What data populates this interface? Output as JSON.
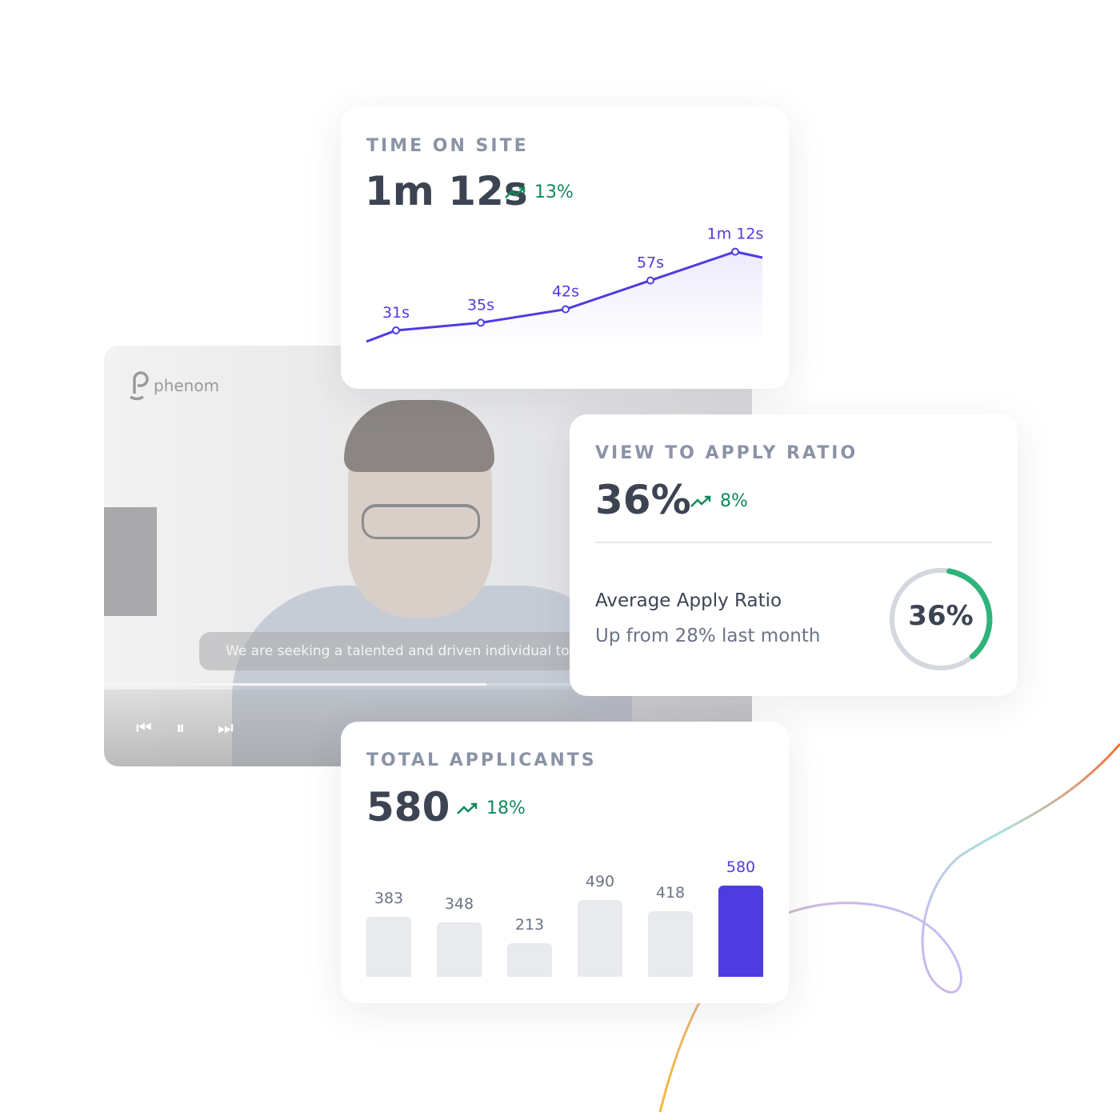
{
  "video": {
    "brand": "phenom",
    "caption": "We are seeking a talented and driven individual to",
    "progress": 0.59
  },
  "time_on_site": {
    "label": "TIME ON SITE",
    "value": "1m 12s",
    "trend": "13%",
    "points": [
      {
        "label": "31s",
        "seconds": 31
      },
      {
        "label": "35s",
        "seconds": 35
      },
      {
        "label": "42s",
        "seconds": 42
      },
      {
        "label": "57s",
        "seconds": 57
      },
      {
        "label": "1m 12s",
        "seconds": 72
      }
    ]
  },
  "view_to_apply": {
    "label": "VIEW TO APPLY RATIO",
    "value": "36%",
    "trend": "8%",
    "avg_title": "Average Apply Ratio",
    "avg_sub": "Up from 28% last month",
    "gauge_label": "36%",
    "gauge_value": 0.36
  },
  "total_applicants": {
    "label": "TOTAL APPLICANTS",
    "value": "580",
    "trend": "18%",
    "bars": [
      {
        "label": "383",
        "value": 383
      },
      {
        "label": "348",
        "value": 348
      },
      {
        "label": "213",
        "value": 213
      },
      {
        "label": "490",
        "value": 490
      },
      {
        "label": "418",
        "value": 418
      },
      {
        "label": "580",
        "value": 580
      }
    ]
  },
  "colors": {
    "accent": "#4f3bdf",
    "trend": "#0f8a5a",
    "bar": "#e9eaee",
    "text": "#3c4452",
    "label": "#8a93a6",
    "gauge": "#2fb37a"
  }
}
